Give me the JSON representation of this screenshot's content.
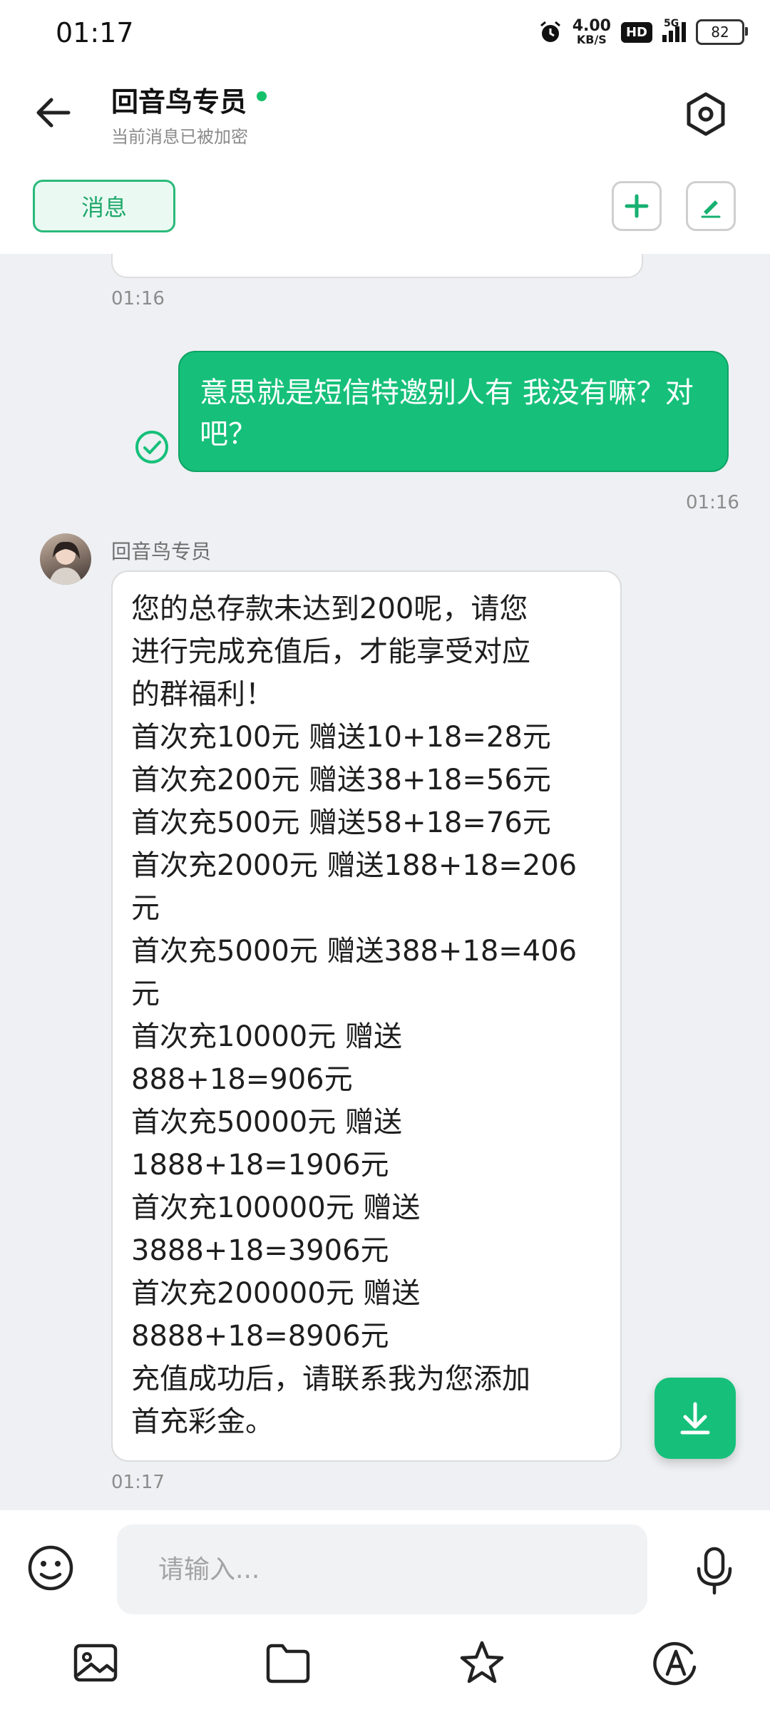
{
  "status": {
    "time": "01:17",
    "speed_value": "4.00",
    "speed_unit": "KB/S",
    "hd_label": "HD",
    "network": "5G",
    "battery": "82"
  },
  "header": {
    "title": "回音鸟专员",
    "subtitle": "当前消息已被加密",
    "tab_label": "消息"
  },
  "messages": {
    "prev_time": "01:16",
    "sent": {
      "text": "意思就是短信特邀别人有  我没有嘛？对吧？",
      "time": "01:16"
    },
    "received": {
      "sender": "回音鸟专员",
      "lines": [
        "您的总存款未达到200呢，请您",
        "进行完成充值后，才能享受对应",
        "的群福利！",
        "首次充100元 赠送10+18=28元",
        "首次充200元 赠送38+18=56元",
        "首次充500元 赠送58+18=76元",
        "首次充2000元 赠送188+18=206",
        "元",
        "首次充5000元 赠送388+18=406",
        "元",
        "首次充10000元 赠送",
        "888+18=906元",
        "首次充50000元 赠送",
        "1888+18=1906元",
        "首次充100000元 赠送",
        "3888+18=3906元",
        "首次充200000元 赠送",
        "8888+18=8906元",
        "充值成功后，请联系我为您添加",
        "首充彩金。"
      ],
      "time": "01:17"
    }
  },
  "input": {
    "placeholder": "请输入..."
  },
  "colors": {
    "accent": "#16c07a",
    "chat_bg": "#eef0f3"
  }
}
